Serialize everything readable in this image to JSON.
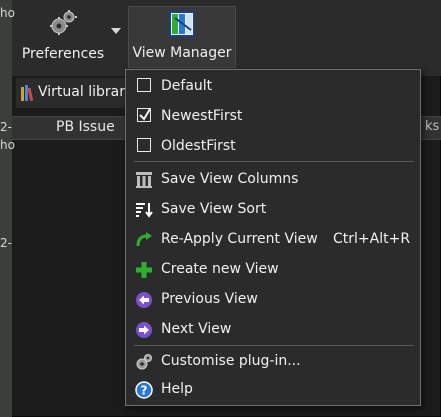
{
  "toolbar": {
    "preferences_label": "Preferences",
    "view_manager_label": "View Manager",
    "virtual_library_label": "Virtual library"
  },
  "left_fragments": [
    "ho",
    "2-",
    "ho",
    "2-"
  ],
  "columns": {
    "pb_issue": "PB Issue",
    "partial_right": "ks"
  },
  "menu": {
    "items": [
      {
        "label": "Default",
        "checked": false
      },
      {
        "label": "NewestFirst",
        "checked": true
      },
      {
        "label": "OldestFirst",
        "checked": false
      },
      {
        "label": "Save View Columns",
        "icon": "columns-icon"
      },
      {
        "label": "Save View Sort",
        "icon": "sort-icon"
      },
      {
        "label": "Re-Apply Current View",
        "shortcut": "Ctrl+Alt+R",
        "icon": "reapply-arrow-icon"
      },
      {
        "label": "Create new View",
        "icon": "plus-icon"
      },
      {
        "label": "Previous View",
        "icon": "previous-icon"
      },
      {
        "label": "Next View",
        "icon": "next-icon"
      },
      {
        "label": "Customise plug-in...",
        "icon": "gears-icon"
      },
      {
        "label": "Help",
        "icon": "help-icon"
      }
    ]
  },
  "colors": {
    "accent_green": "#2fae2f",
    "accent_purple": "#7a4fd0",
    "help_blue": "#2a78d6"
  }
}
